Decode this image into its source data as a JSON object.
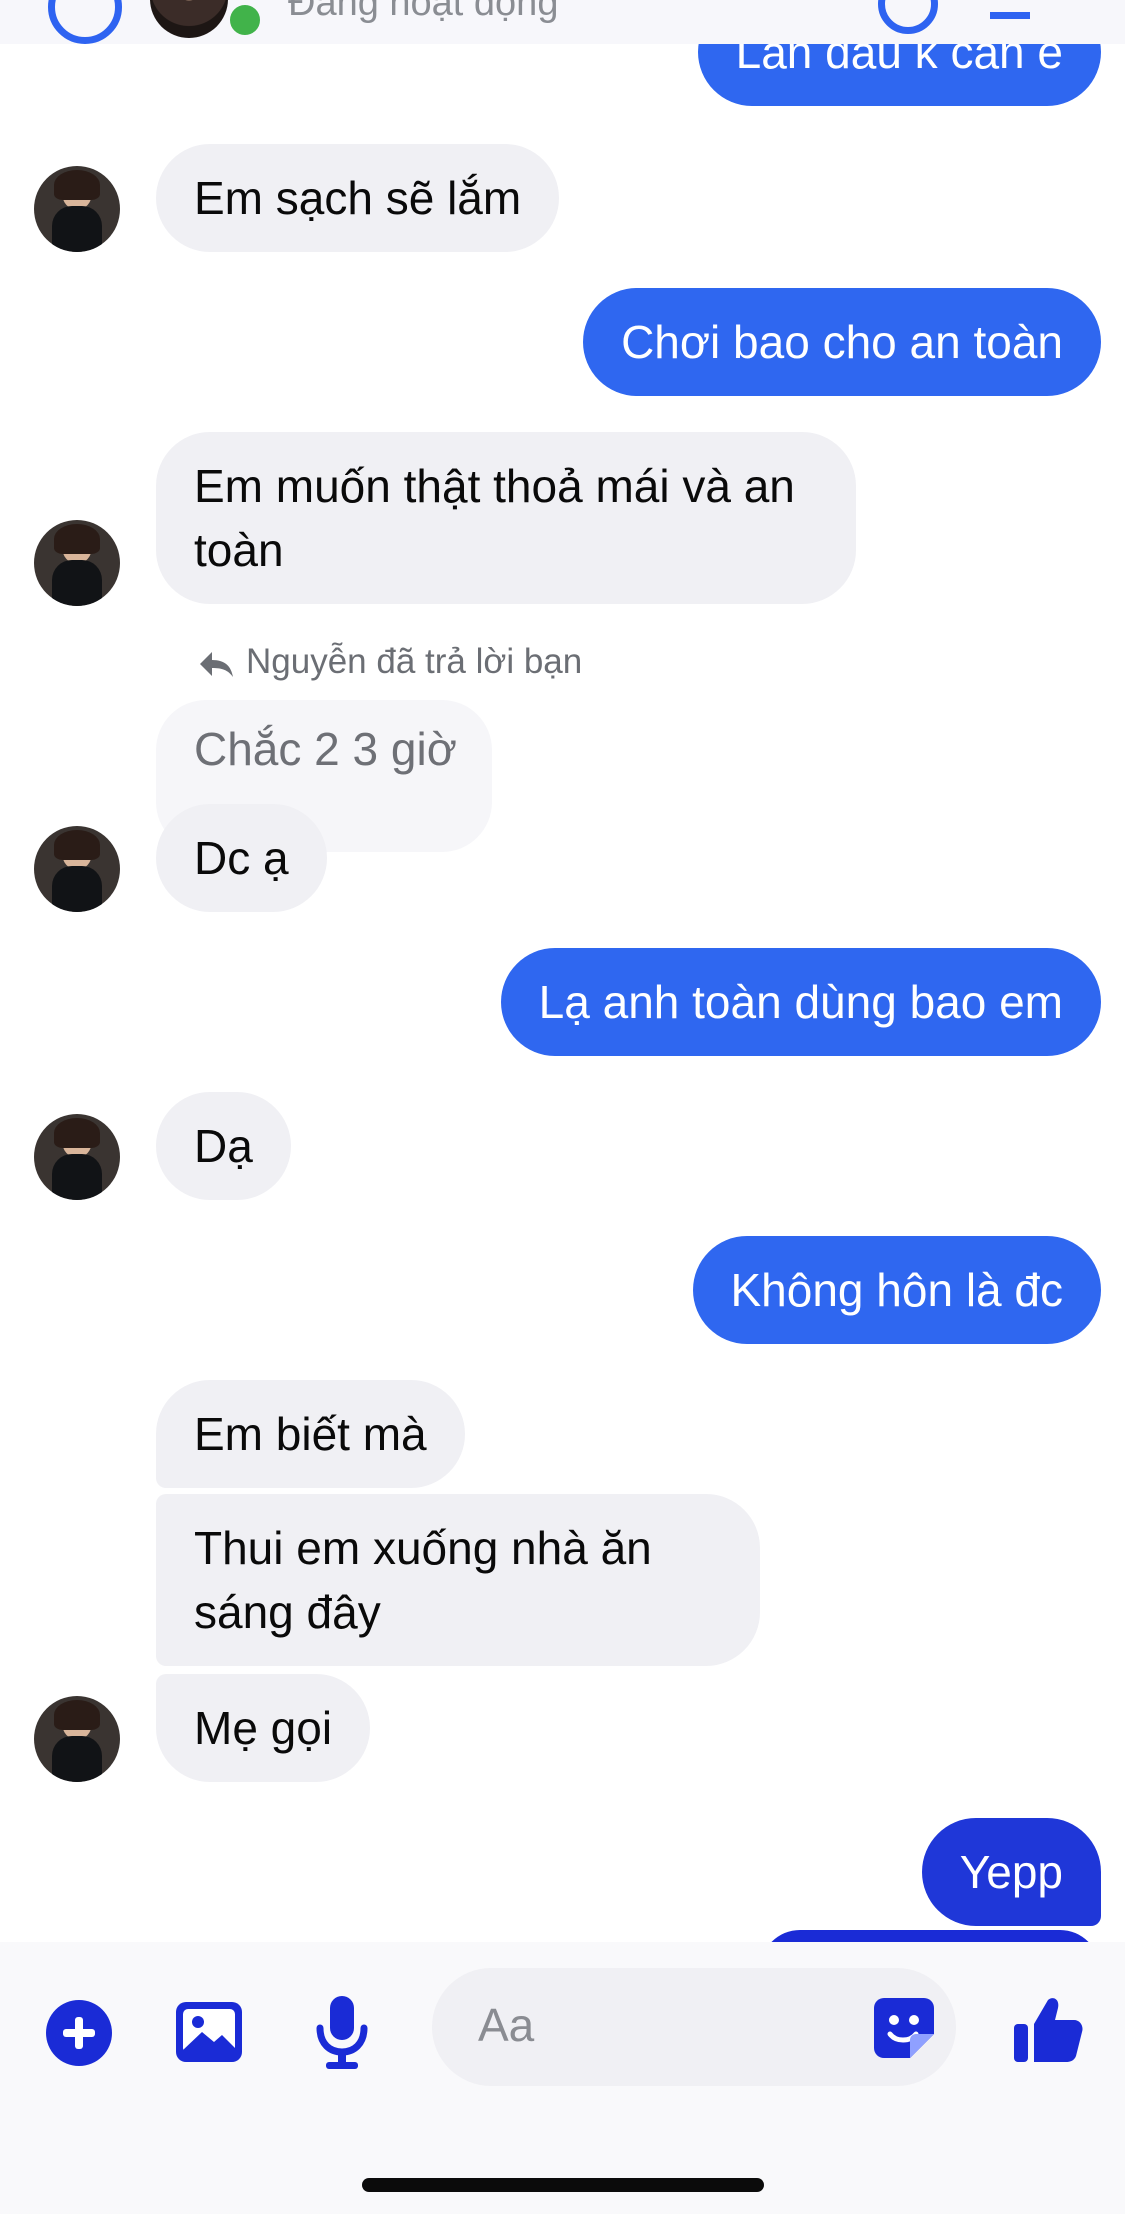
{
  "header": {
    "status": "Đang hoạt động"
  },
  "messages": [
    {
      "id": "m1",
      "side": "out",
      "text": "Lần đầu k cần e"
    },
    {
      "id": "m2",
      "side": "in",
      "text": "Em sạch sẽ lắm"
    },
    {
      "id": "m3",
      "side": "out",
      "text": "Chơi bao cho an toàn"
    },
    {
      "id": "m4",
      "side": "in",
      "text": "Em muốn thật thoả mái và an toàn"
    },
    {
      "id": "m5",
      "side": "in",
      "reply_label": "Nguyễn đã trả lời bạn",
      "quoted": "Chắc 2 3 giờ",
      "text": "Dc ạ"
    },
    {
      "id": "m6",
      "side": "out",
      "text": "Lạ anh toàn dùng bao em"
    },
    {
      "id": "m7",
      "side": "in",
      "text": "Dạ"
    },
    {
      "id": "m8",
      "side": "out",
      "text": "Không hôn là đc"
    },
    {
      "id": "m9",
      "side": "in",
      "text": "Em biết mà"
    },
    {
      "id": "m10",
      "side": "in",
      "text": "Thui em xuống nhà ăn sáng đây"
    },
    {
      "id": "m11",
      "side": "in",
      "text": "Mẹ gọi"
    },
    {
      "id": "m12",
      "side": "out",
      "text": "Yepp"
    }
  ],
  "composer": {
    "placeholder": "Aa",
    "icons": [
      "plus-icon",
      "image-icon",
      "microphone-icon",
      "sticker-icon",
      "thumbs-up-icon"
    ]
  },
  "colors": {
    "outgoing_bubble": "#2f67f0",
    "outgoing_bubble_latest": "#1f37d8",
    "incoming_bubble": "#f0f0f4",
    "accent": "#1a2bd6"
  }
}
